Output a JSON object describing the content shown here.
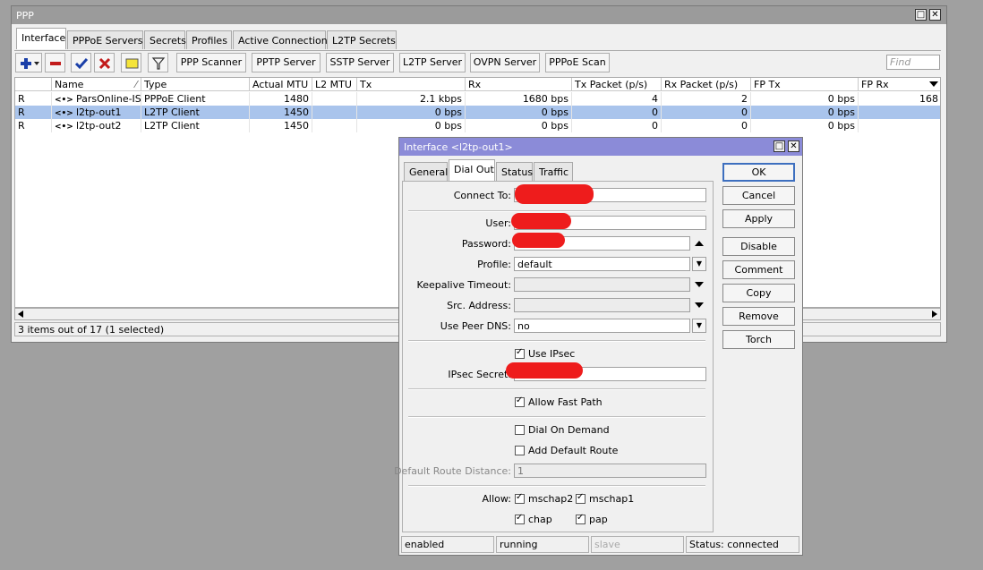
{
  "ppp_window": {
    "title": "PPP",
    "tabs": [
      "Interface",
      "PPPoE Servers",
      "Secrets",
      "Profiles",
      "Active Connections",
      "L2TP Secrets"
    ],
    "toolbar_buttons": [
      "PPP Scanner",
      "PPTP Server",
      "SSTP Server",
      "L2TP Server",
      "OVPN Server",
      "PPPoE Scan"
    ],
    "find_placeholder": "Find",
    "columns": [
      "",
      "Name",
      "Type",
      "Actual MTU",
      "L2 MTU",
      "Tx",
      "Rx",
      "Tx Packet (p/s)",
      "Rx Packet (p/s)",
      "FP Tx",
      "FP Rx"
    ],
    "rows": [
      {
        "flag": "R",
        "name": "ParsOnline-ISP",
        "type": "PPPoE Client",
        "mtu": "1480",
        "l2mtu": "",
        "tx": "2.1 kbps",
        "rx": "1680 bps",
        "txp": "4",
        "rxp": "2",
        "fptx": "0 bps",
        "fprx": "168"
      },
      {
        "flag": "R",
        "name": "l2tp-out1",
        "type": "L2TP Client",
        "mtu": "1450",
        "l2mtu": "",
        "tx": "0 bps",
        "rx": "0 bps",
        "txp": "0",
        "rxp": "0",
        "fptx": "0 bps",
        "fprx": ""
      },
      {
        "flag": "R",
        "name": "l2tp-out2",
        "type": "L2TP Client",
        "mtu": "1450",
        "l2mtu": "",
        "tx": "0 bps",
        "rx": "0 bps",
        "txp": "0",
        "rxp": "0",
        "fptx": "0 bps",
        "fprx": ""
      }
    ],
    "selected_row": 1,
    "status": "3 items out of 17 (1 selected)"
  },
  "dialog": {
    "title": "Interface <l2tp-out1>",
    "tabs": [
      "General",
      "Dial Out",
      "Status",
      "Traffic"
    ],
    "active_tab": "Dial Out",
    "labels": {
      "connect_to": "Connect To:",
      "user": "User:",
      "password": "Password:",
      "profile": "Profile:",
      "keepalive": "Keepalive Timeout:",
      "src_address": "Src. Address:",
      "use_peer_dns": "Use Peer DNS:",
      "use_ipsec": "Use IPsec",
      "ipsec_secret": "IPsec Secret:",
      "allow_fast_path": "Allow Fast Path",
      "dial_on_demand": "Dial On Demand",
      "add_default_route": "Add Default Route",
      "default_route_distance": "Default Route Distance:",
      "allow": "Allow:",
      "mschap2": "mschap2",
      "mschap1": "mschap1",
      "chap": "chap",
      "pap": "pap"
    },
    "values": {
      "profile": "default",
      "use_peer_dns": "no",
      "default_route_distance": "1"
    },
    "checks": {
      "use_ipsec": true,
      "allow_fast_path": true,
      "dial_on_demand": false,
      "add_default_route": false,
      "mschap2": true,
      "mschap1": true,
      "chap": true,
      "pap": true
    },
    "buttons": [
      "OK",
      "Cancel",
      "Apply",
      "Disable",
      "Comment",
      "Copy",
      "Remove",
      "Torch"
    ],
    "status": [
      "enabled",
      "running",
      "slave",
      "Status: connected"
    ],
    "redaction_color": "#ee1c1c"
  }
}
